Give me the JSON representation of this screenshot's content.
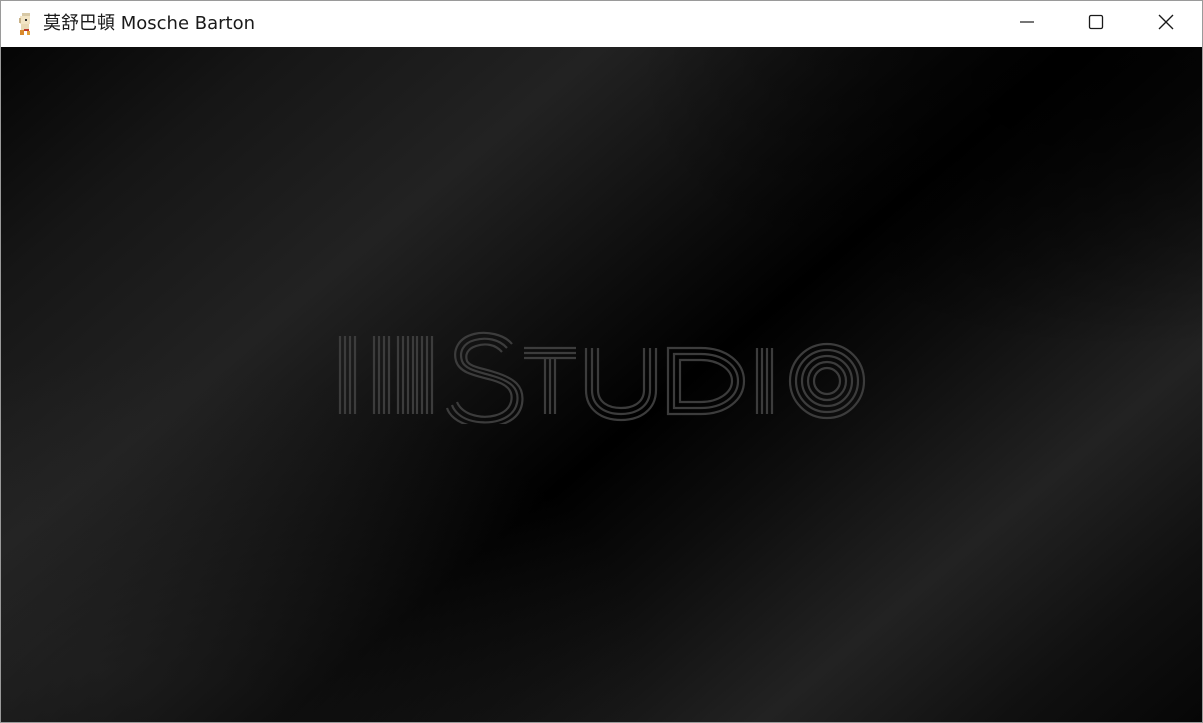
{
  "window": {
    "title": "莫舒巴頓 Mosche Barton",
    "icon": "app-character-icon"
  },
  "caption_buttons": {
    "minimize": "minimize-icon",
    "maximize": "maximize-icon",
    "close": "close-icon"
  },
  "splash": {
    "logo_text": "STUDIO",
    "logo_color": "#3c3c3c",
    "background_dark": "#000000",
    "background_light": "#222222"
  }
}
